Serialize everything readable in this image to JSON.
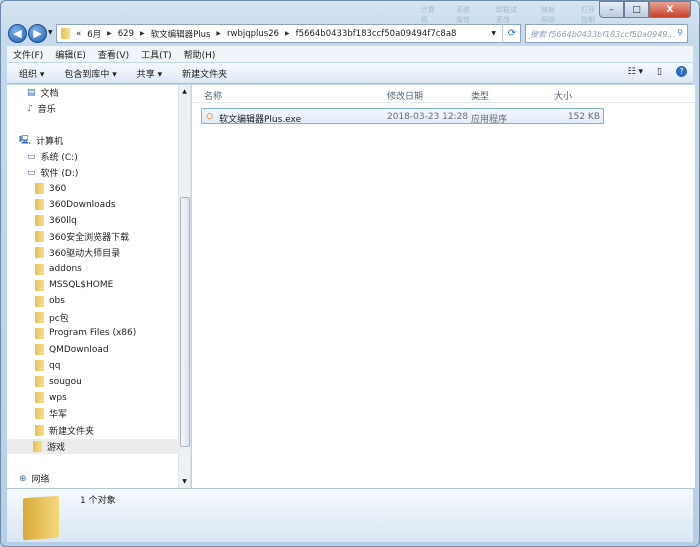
{
  "title_bar": {
    "blurred": [
      "计算机",
      "系统属性",
      "卸载或更改",
      "映射网络",
      "打开控制"
    ]
  },
  "window_controls": {
    "minimize": "–",
    "maximize": "□",
    "close": "X"
  },
  "address": {
    "path": [
      "«",
      "6月",
      "629",
      "软文编辑器Plus",
      "rwbjqplus26",
      "f5664b0433bf183ccf50a09494f7c8a8"
    ]
  },
  "search": {
    "placeholder": "搜索 f5664b0433bf183ccf50a0949..."
  },
  "menu": [
    "文件(F)",
    "编辑(E)",
    "查看(V)",
    "工具(T)",
    "帮助(H)"
  ],
  "toolbar": {
    "organize": "组织 ▾",
    "include": "包含到库中 ▾",
    "share": "共享 ▾",
    "new_folder": "新建文件夹"
  },
  "nav": {
    "libraries": [
      "文档",
      "音乐"
    ],
    "computer": "计算机",
    "drives": [
      "系统 (C:)",
      "软件 (D:)"
    ],
    "folders": [
      "360",
      "360Downloads",
      "360llq",
      "360安全浏览器下载",
      "360驱动大师目录",
      "addons",
      "MSSQL$HOME",
      "obs",
      "pc包",
      "Program Files (x86)",
      "QMDownload",
      "qq",
      "sougou",
      "wps",
      "华军",
      "新建文件夹",
      "游戏"
    ],
    "selected": "游戏",
    "network": "网络"
  },
  "columns": [
    "名称",
    "修改日期",
    "类型",
    "大小"
  ],
  "files": [
    {
      "name": "软文编辑器Plus.exe",
      "modified": "2018-03-23 12:28",
      "type": "应用程序",
      "size": "152 KB"
    }
  ],
  "details": {
    "count": "1 个对象"
  }
}
